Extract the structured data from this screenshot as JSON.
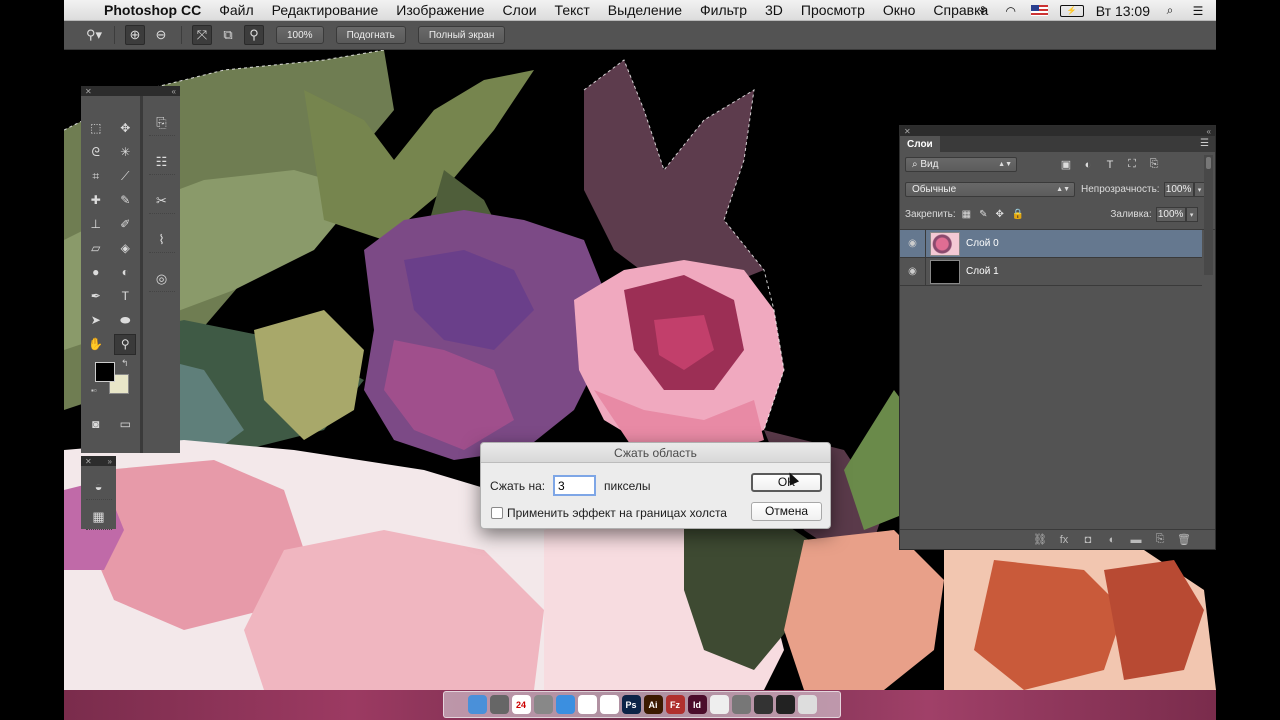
{
  "menubar": {
    "app_name": "Photoshop CC",
    "items": [
      "Файл",
      "Редактирование",
      "Изображение",
      "Слои",
      "Текст",
      "Выделение",
      "Фильтр",
      "3D",
      "Просмотр",
      "Окно",
      "Справка"
    ],
    "clock": "Вт 13:09",
    "status_icons": [
      "extension-icon",
      "wifi-icon",
      "flag-us-icon",
      "battery-icon",
      "search-icon",
      "list-icon"
    ]
  },
  "options_bar": {
    "zoom_value": "100%",
    "fit_label": "Подогнать",
    "fullscreen_label": "Полный экран"
  },
  "tools": {
    "foreground_color": "#000000",
    "background_color": "#e8e6c8"
  },
  "layers_panel": {
    "tab_label": "Слои",
    "filter_label": "Вид",
    "blend_mode": "Обычные",
    "opacity_label": "Непрозрачность:",
    "opacity_value": "100%",
    "lock_label": "Закрепить:",
    "fill_label": "Заливка:",
    "fill_value": "100%",
    "layers": [
      {
        "name": "Слой 0",
        "selected": true
      },
      {
        "name": "Слой 1",
        "selected": false
      }
    ]
  },
  "dialog": {
    "title": "Сжать область",
    "contract_label": "Сжать на:",
    "contract_value": "3",
    "unit": "пикселы",
    "apply_canvas_label": "Применить эффект на границах холста",
    "ok_label": "OK",
    "cancel_label": "Отмена"
  },
  "dock": {
    "apps": [
      {
        "name": "finder-icon",
        "color": "#4a90d9",
        "label": ""
      },
      {
        "name": "launchpad-icon",
        "color": "#666",
        "label": ""
      },
      {
        "name": "calendar-icon",
        "color": "#fff",
        "label": "24"
      },
      {
        "name": "system-prefs-icon",
        "color": "#888",
        "label": ""
      },
      {
        "name": "safari-icon",
        "color": "#3b8fe0",
        "label": ""
      },
      {
        "name": "acrobat-icon",
        "color": "#fff",
        "label": ""
      },
      {
        "name": "acrobat-pro-icon",
        "color": "#fff",
        "label": ""
      },
      {
        "name": "photoshop-icon",
        "color": "#0b2447",
        "label": "Ps"
      },
      {
        "name": "illustrator-icon",
        "color": "#3b1a00",
        "label": "Ai"
      },
      {
        "name": "filezilla-icon",
        "color": "#b0302e",
        "label": "Fz"
      },
      {
        "name": "indesign-icon",
        "color": "#4b0c2b",
        "label": "Id"
      },
      {
        "name": "textedit-icon",
        "color": "#eee",
        "label": ""
      },
      {
        "name": "tripmode-icon",
        "color": "#777",
        "label": ""
      },
      {
        "name": "clapper-icon",
        "color": "#333",
        "label": ""
      },
      {
        "name": "photo-booth-icon",
        "color": "#222",
        "label": ""
      },
      {
        "name": "trash-icon",
        "color": "#ddd",
        "label": ""
      }
    ]
  }
}
